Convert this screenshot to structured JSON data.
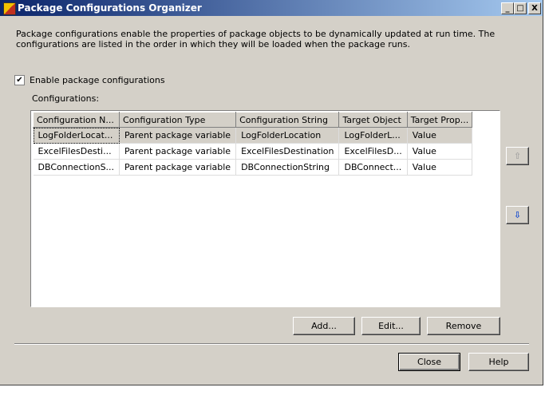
{
  "window": {
    "title": "Package Configurations Organizer",
    "min": "_",
    "max": "□",
    "close": "X"
  },
  "description": "Package configurations enable the properties of package objects to be dynamically updated at run time. The configurations are listed in the order in which they will be loaded when the package runs.",
  "enable_label": "Enable package configurations",
  "enable_checked": true,
  "check_glyph": "✔",
  "configs_label": "Configurations:",
  "columns": [
    "Configuration N...",
    "Configuration Type",
    "Configuration String",
    "Target Object",
    "Target Prop..."
  ],
  "rows": [
    [
      "LogFolderLocat...",
      "Parent package variable",
      "LogFolderLocation",
      "LogFolderL...",
      "Value"
    ],
    [
      "ExcelFilesDesti...",
      "Parent package variable",
      "ExcelFilesDestination",
      "ExcelFilesD...",
      "Value"
    ],
    [
      "DBConnectionS...",
      "Parent package variable",
      "DBConnectionString",
      "DBConnect...",
      "Value"
    ]
  ],
  "buttons": {
    "up": "⇧",
    "down": "⇩",
    "add": "Add...",
    "edit": "Edit...",
    "remove": "Remove",
    "close": "Close",
    "help": "Help"
  }
}
